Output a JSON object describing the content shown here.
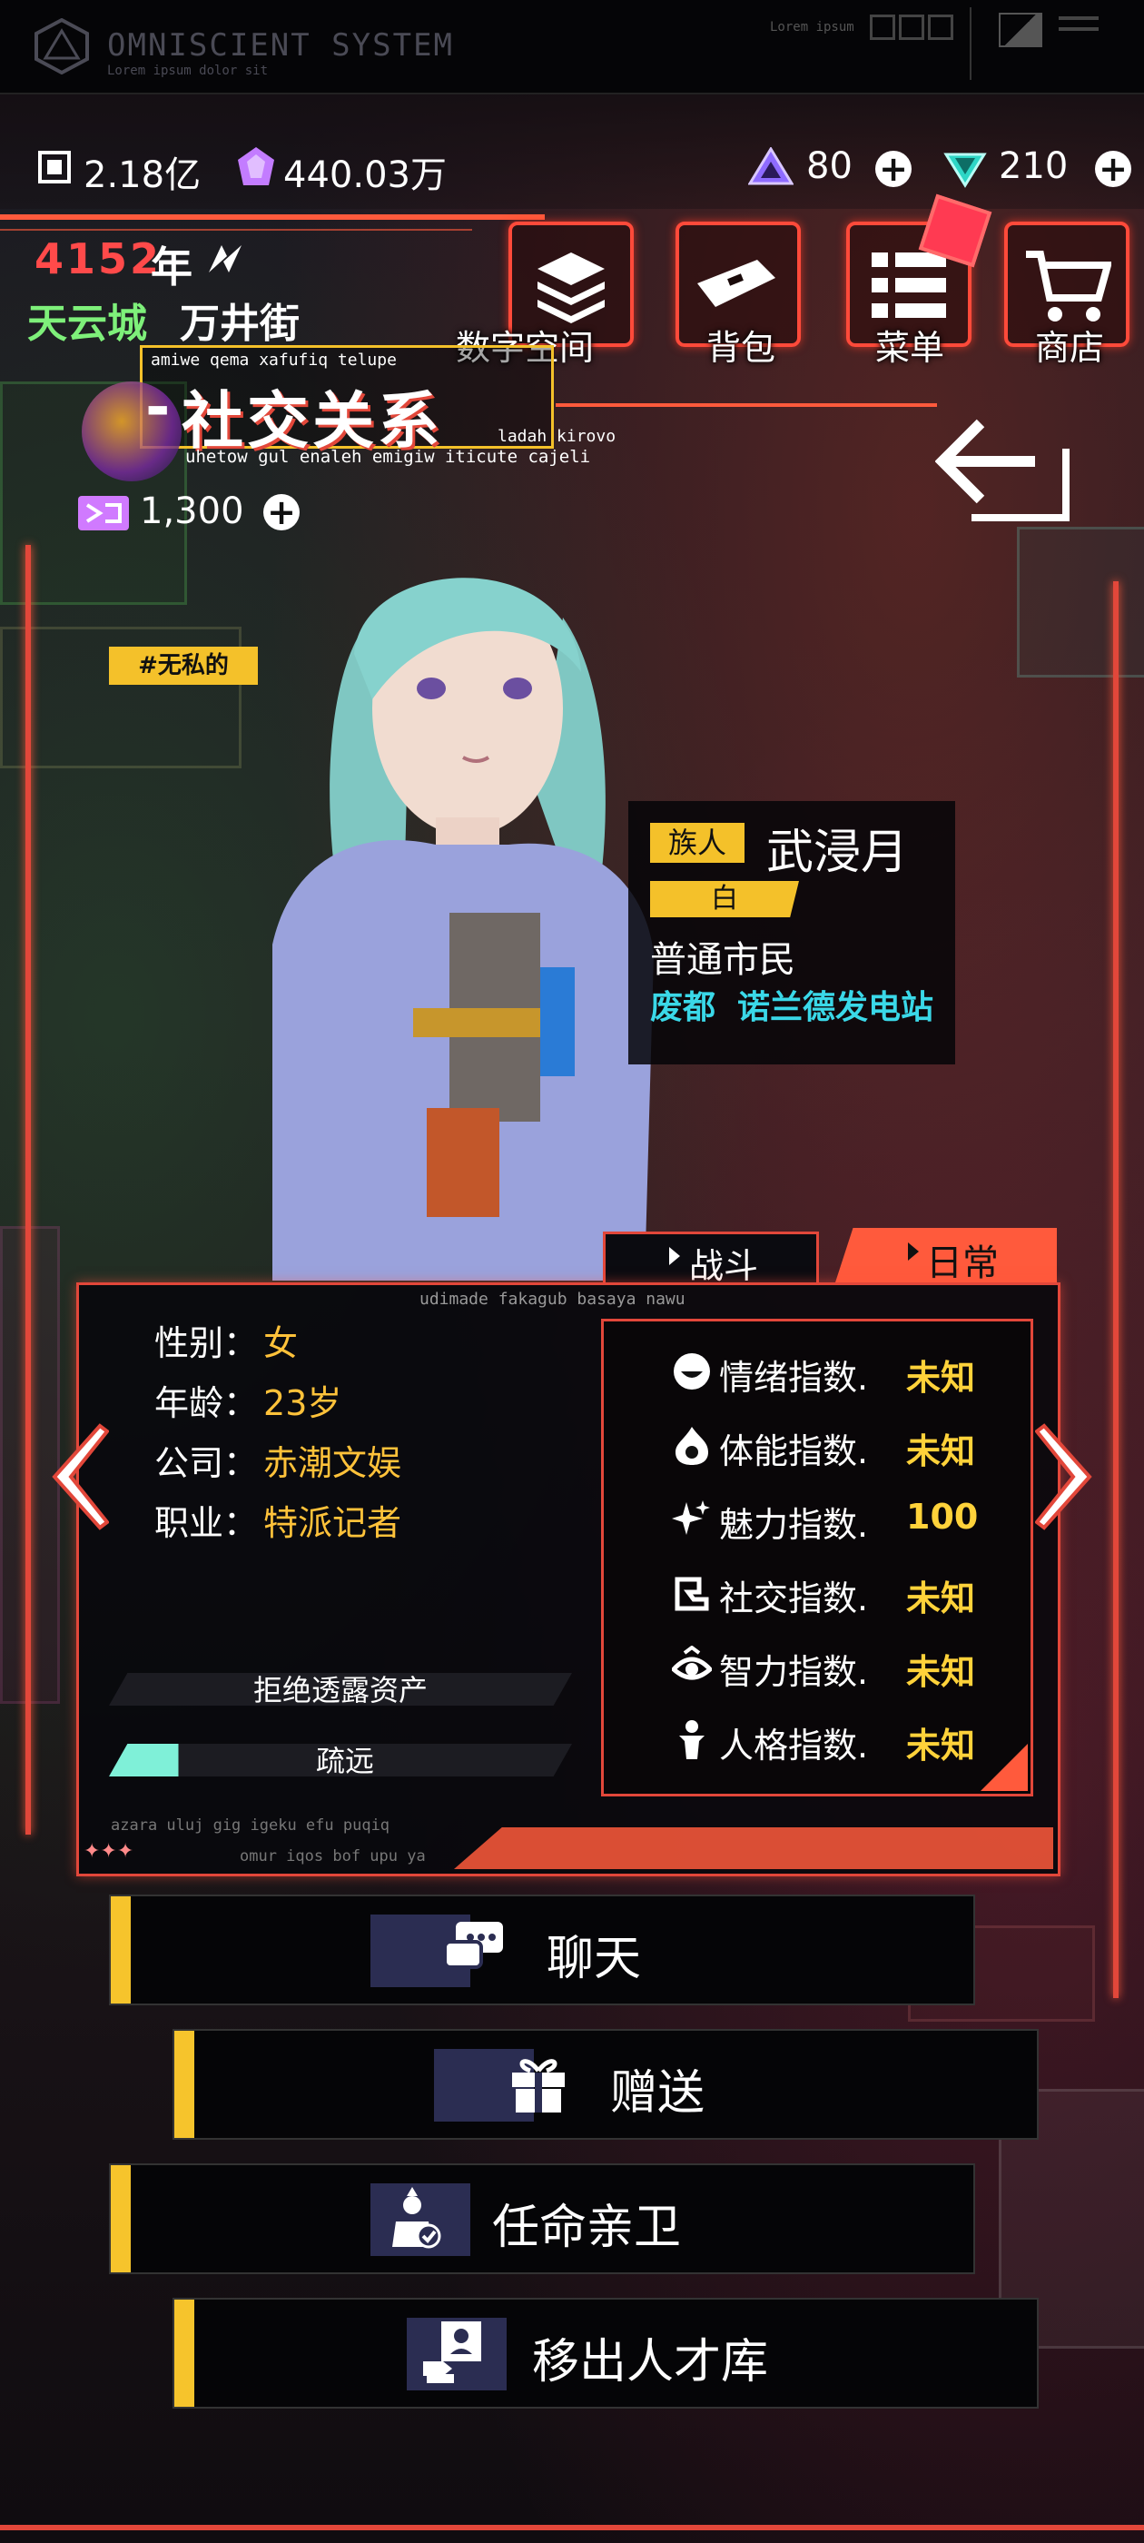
{
  "topbar": {
    "brand": "OMNISCIENT  SYSTEM",
    "brand_sub": "Lorem ipsum dolor sit",
    "small_label": "Lorem ipsum"
  },
  "resources": {
    "chips": "2.18亿",
    "crystals": "440.03万",
    "gems": "80",
    "diamonds": "210",
    "tokens": "1,300"
  },
  "location": {
    "year": "4152",
    "year_unit": "年",
    "city": "天云城",
    "street": "万井街"
  },
  "menu": [
    {
      "label": "数字空间"
    },
    {
      "label": "背包"
    },
    {
      "label": "菜单"
    },
    {
      "label": "商店"
    }
  ],
  "page": {
    "title": "社交关系",
    "title_prefix": "-",
    "caption_top": "amiwe qema xafufiq telupe",
    "caption_bottom": "uhetow gul enaleh emigiw iticute cajeli",
    "caption_right": "ladah kirovo"
  },
  "character": {
    "trait_tag": "#无私的",
    "race": "族人",
    "name": "武浸月",
    "color_tag": "白",
    "class": "普通市民",
    "district": "废都",
    "workplace": "诺兰德发电站"
  },
  "tabs": {
    "battle": "战斗",
    "daily": "日常",
    "panel_caption": "udimade fakagub basaya nawu"
  },
  "profile": [
    {
      "key": "性别",
      "value": "女"
    },
    {
      "key": "年龄",
      "value": "23岁"
    },
    {
      "key": "公司",
      "value": "赤潮文娱"
    },
    {
      "key": "职业",
      "value": "特派记者"
    }
  ],
  "status": {
    "assets": "拒绝透露资产",
    "relation": "疏远",
    "relation_level": 0.15,
    "footer_a": "azara uluj gig igeku efu puqiq",
    "footer_b": "omur iqos bof upu ya"
  },
  "stats": [
    {
      "name": "情绪指数.",
      "value": "未知",
      "icon": "emotion-icon"
    },
    {
      "name": "体能指数.",
      "value": "未知",
      "icon": "stamina-icon"
    },
    {
      "name": "魅力指数.",
      "value": "100",
      "icon": "charm-icon"
    },
    {
      "name": "社交指数.",
      "value": "未知",
      "icon": "social-icon"
    },
    {
      "name": "智力指数.",
      "value": "未知",
      "icon": "intellect-icon"
    },
    {
      "name": "人格指数.",
      "value": "未知",
      "icon": "personality-icon"
    }
  ],
  "actions": [
    {
      "label": "聊天",
      "icon": "chat-icon"
    },
    {
      "label": "赠送",
      "icon": "gift-icon"
    },
    {
      "label": "任命亲卫",
      "icon": "appoint-guard-icon"
    },
    {
      "label": "移出人才库",
      "icon": "remove-talent-icon"
    }
  ],
  "colors": {
    "accent_red": "#ff4a3a",
    "accent_yellow": "#f6c42c",
    "value_yellow": "#ffd23a",
    "cyan_text": "#3ad8e8",
    "green_text": "#7ef07a"
  }
}
